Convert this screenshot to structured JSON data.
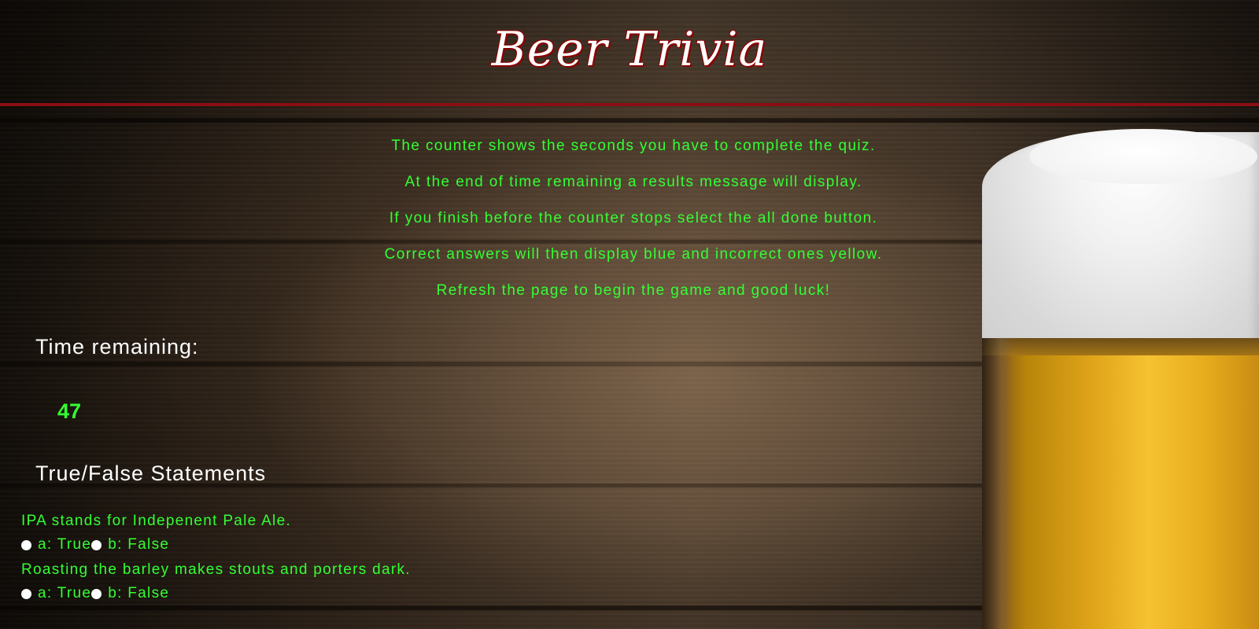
{
  "header": {
    "title": "Beer Trivia"
  },
  "instructions": [
    "The counter shows the seconds you have to complete the quiz.",
    "At the end of time remaining a results message will display.",
    "If you finish before the counter stops select the all done button.",
    "Correct answers will then display blue and incorrect ones yellow.",
    "Refresh the page to begin the game and good luck!"
  ],
  "timer": {
    "label": "Time remaining:",
    "value": "47"
  },
  "section": {
    "title": "True/False Statements"
  },
  "questions": [
    {
      "text": "IPA stands for Indepenent Pale Ale.",
      "option_a": "a: True",
      "option_b": "b: False"
    },
    {
      "text": "Roasting the barley makes stouts and porters dark.",
      "option_a": "a: True",
      "option_b": "b: False"
    }
  ],
  "colors": {
    "accent_green": "#33ff33",
    "rule_red": "#8a0f14"
  }
}
